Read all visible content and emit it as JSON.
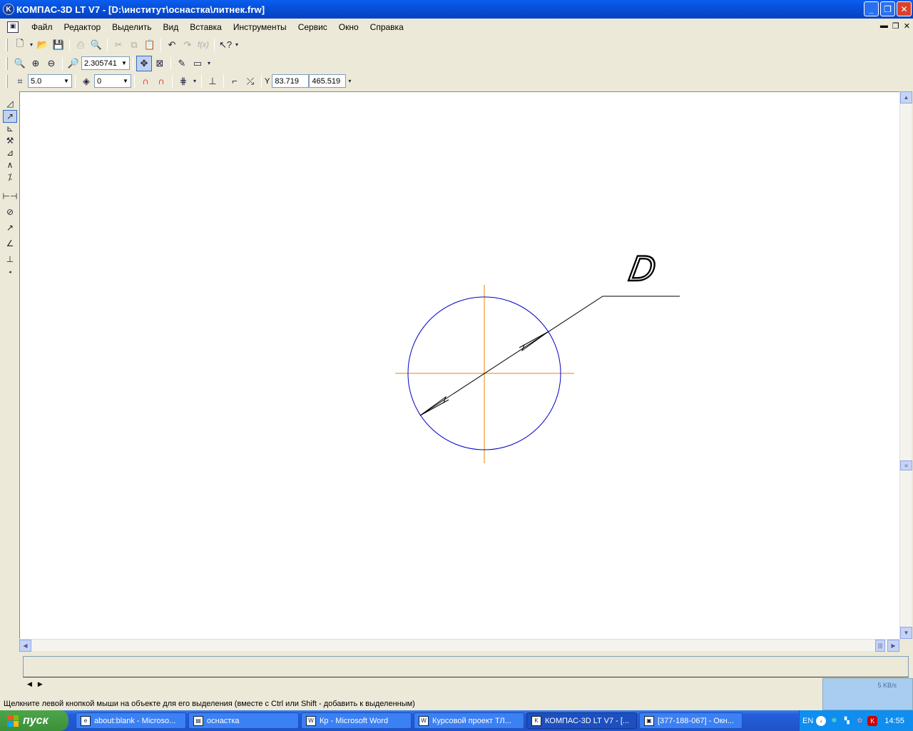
{
  "window": {
    "title": "КОМПАС-3D LT V7 - [D:\\институт\\оснастка\\литнек.frw]"
  },
  "menu": [
    "Файл",
    "Редактор",
    "Выделить",
    "Вид",
    "Вставка",
    "Инструменты",
    "Сервис",
    "Окно",
    "Справка"
  ],
  "toolbar": {
    "zoom_value": "2.305741",
    "step_value": "5.0",
    "layer_value": "0",
    "coord_x": "83.719",
    "coord_y": "465.519",
    "coord_label": "Y"
  },
  "drawing": {
    "dimension_text": "D",
    "colors": {
      "circle": "#0000c8",
      "axis": "#e08a00",
      "dimension": "#000000"
    }
  },
  "status": {
    "hint": "Щелкните левой кнопкой мыши на объекте для его выделения (вместе с Ctrl или Shift - добавить к выделенным)"
  },
  "network": {
    "speed": "5 KB/s"
  },
  "taskbar": {
    "start_label": "пуск",
    "tasks": [
      {
        "label": "about:blank - Microso..."
      },
      {
        "label": "оснастка"
      },
      {
        "label": "Кр - Microsoft Word"
      },
      {
        "label": "Курсовой проект ТЛ..."
      },
      {
        "label": "КОМПАС-3D LT V7 - [..."
      },
      {
        "label": "[377-188-067] - Окн..."
      }
    ],
    "lang": "EN",
    "clock": "14:55"
  }
}
